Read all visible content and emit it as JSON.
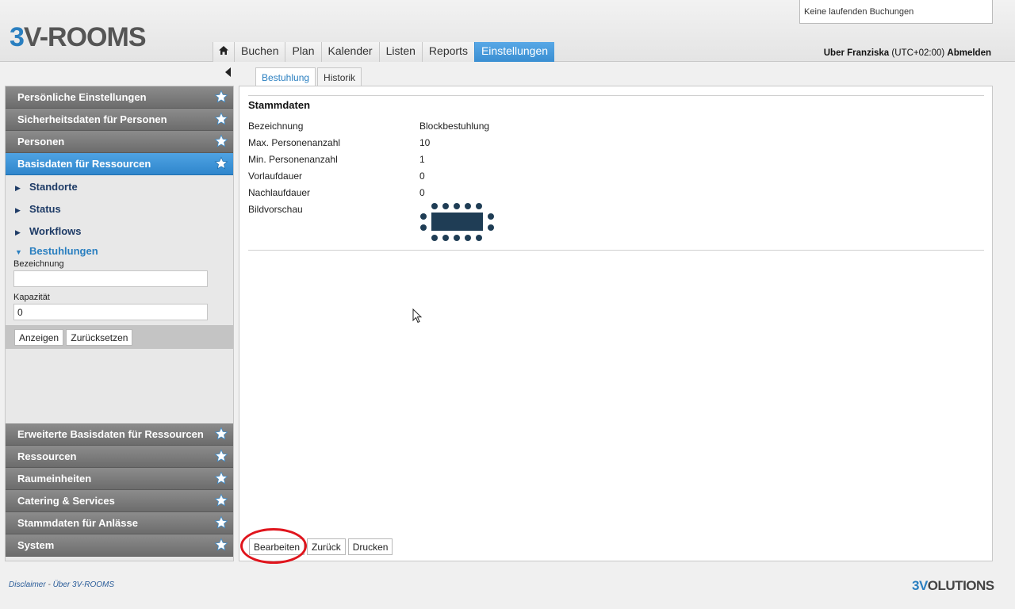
{
  "header": {
    "logo_prefix": "3",
    "logo_rest": "V-ROOMS",
    "booking_status": "Keine laufenden Buchungen",
    "user_name": "Uber Franziska",
    "timezone": "(UTC+02:00)",
    "logout_label": "Abmelden"
  },
  "nav": {
    "home_icon": "home-icon",
    "items": [
      "Buchen",
      "Plan",
      "Kalender",
      "Listen",
      "Reports",
      "Einstellungen"
    ],
    "active": "Einstellungen"
  },
  "sidebar": {
    "top_sections": [
      "Persönliche Einstellungen",
      "Sicherheitsdaten für Personen",
      "Personen",
      "Basisdaten für Ressourcen"
    ],
    "active_section": "Basisdaten für Ressourcen",
    "sub_items": [
      "Standorte",
      "Status",
      "Workflows",
      "Bestuhlungen"
    ],
    "open_sub_item": "Bestuhlungen",
    "filter": {
      "bezeichnung_label": "Bezeichnung",
      "bezeichnung_value": "",
      "kapazitaet_label": "Kapazität",
      "kapazitaet_value": "0",
      "show_button": "Anzeigen",
      "reset_button": "Zurücksetzen"
    },
    "bottom_sections": [
      "Erweiterte Basisdaten für Ressourcen",
      "Ressourcen",
      "Raumeinheiten",
      "Catering & Services",
      "Stammdaten für Anlässe",
      "System"
    ]
  },
  "tabs": {
    "items": [
      "Bestuhlung",
      "Historik"
    ],
    "active": "Bestuhlung"
  },
  "details": {
    "section_title": "Stammdaten",
    "rows": [
      {
        "label": "Bezeichnung",
        "value": "Blockbestuhlung"
      },
      {
        "label": "Max. Personenanzahl",
        "value": "10"
      },
      {
        "label": "Min. Personenanzahl",
        "value": "1"
      },
      {
        "label": "Vorlaufdauer",
        "value": "0"
      },
      {
        "label": "Nachlaufdauer",
        "value": "0"
      },
      {
        "label": "Bildvorschau",
        "value": ""
      }
    ]
  },
  "actions": {
    "edit": "Bearbeiten",
    "back": "Zurück",
    "print": "Drucken"
  },
  "footer": {
    "disclaimer": "Disclaimer",
    "separator": "-",
    "about": "Über 3V-ROOMS",
    "company_prefix": "3V",
    "company_rest": "OLUTIONS"
  },
  "colors": {
    "accent": "#3a8fd2",
    "highlight": "#e0151d",
    "sidebar_header": "#7a7a7a",
    "preview": "#1f3d55"
  }
}
